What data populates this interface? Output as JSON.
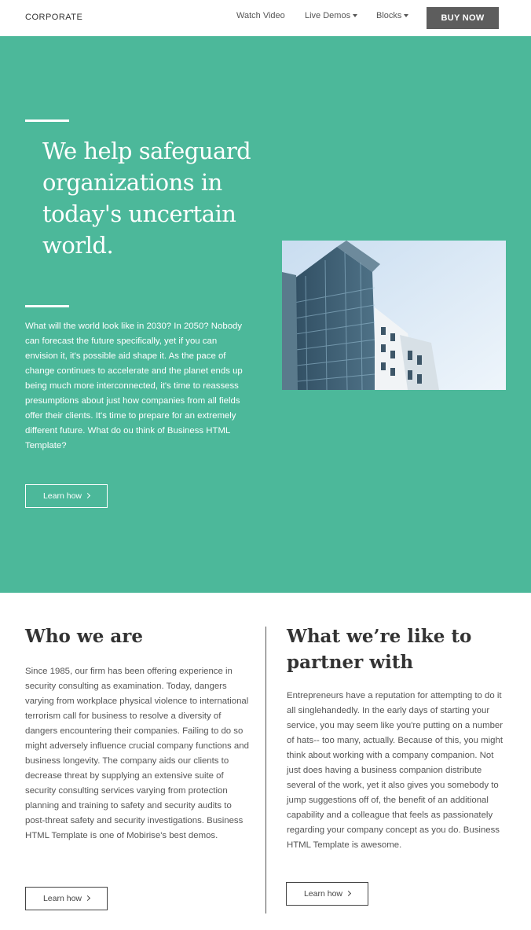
{
  "nav": {
    "brand": "CORPORATE",
    "links": [
      "Watch Video",
      "Live Demos",
      "Blocks"
    ],
    "buy_label": "BUY NOW"
  },
  "hero": {
    "title": "We help safeguard organizations in today's uncertain world.",
    "text": "What will the world look like in 2030? In 2050? Nobody can forecast the future specifically, yet if you can envision it, it's possible aid shape it. As the pace of change continues to accelerate and the planet ends up being much more interconnected, it's time to reassess presumptions about just how companies from all fields offer their clients. It's time to prepare for an extremely different future. What do ou think of Business HTML Template?",
    "button_label": "Learn how"
  },
  "who": {
    "title": "Who we are",
    "text": "Since 1985, our firm has been offering experience in security consulting as examination. Today, dangers varying from workplace physical violence to international terrorism call for business to resolve a diversity of dangers encountering their companies. Failing to do so might adversely influence crucial company functions and business longevity. The company aids our clients to decrease threat by supplying an extensive suite of security consulting services varying from protection planning and training to safety and security audits to post-threat safety and security investigations. Business HTML Template is one of Mobirise's best demos.",
    "button_label": "Learn how"
  },
  "partner": {
    "title": "What we’re like to partner with",
    "text": "Entrepreneurs have a reputation for attempting to do it all singlehandedly. In the early days of starting your service, you may seem like you're putting on a number of hats-- too many, actually. Because of this, you might think about working with a company companion. Not just does having a business companion distribute several of the work, yet it also gives you somebody to jump suggestions off of, the benefit of an additional capability and a colleague that feels as passionately regarding your company concept as you do. Business HTML Template is awesome.",
    "button_label": "Learn how"
  },
  "colors": {
    "hero_bg": "#4cb89a",
    "buy_bg": "#5d5d5d"
  }
}
